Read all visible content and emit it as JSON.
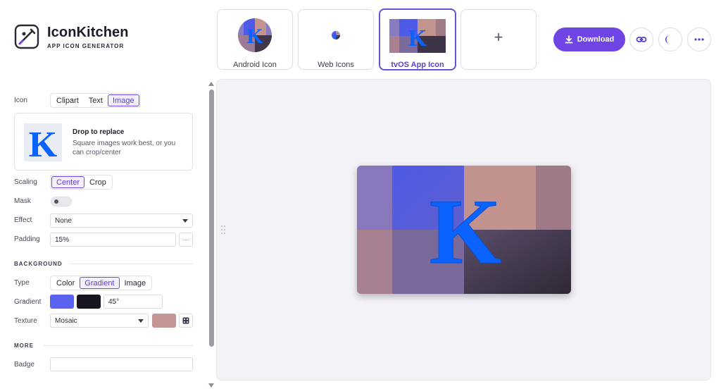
{
  "app": {
    "title": "IconKitchen",
    "subtitle": "APP ICON GENERATOR"
  },
  "targets": [
    {
      "label": "Android Icon",
      "selected": false
    },
    {
      "label": "Web Icons",
      "selected": false
    },
    {
      "label": "tvOS App Icon",
      "selected": true
    },
    {
      "label": "+",
      "selected": false
    }
  ],
  "actions": {
    "download_label": "Download",
    "link_icon": "link-icon",
    "theme_icon": "moon-icon",
    "more_icon": "more-horizontal-icon"
  },
  "icon_section": {
    "label": "Icon",
    "options": [
      "Clipart",
      "Text",
      "Image"
    ],
    "selected": "Image",
    "image_card": {
      "title": "Drop to replace",
      "description": "Square images work best, or you can crop/center",
      "thumb_letter": "K"
    }
  },
  "scaling": {
    "label": "Scaling",
    "options": [
      "Center",
      "Crop"
    ],
    "selected": "Center"
  },
  "mask": {
    "label": "Mask",
    "enabled": false
  },
  "effect": {
    "label": "Effect",
    "value": "None"
  },
  "padding": {
    "label": "Padding",
    "value": "15%",
    "more_label": "···"
  },
  "background": {
    "heading": "BACKGROUND",
    "type": {
      "label": "Type",
      "options": [
        "Color",
        "Gradient",
        "Image"
      ],
      "selected": "Gradient"
    },
    "gradient": {
      "label": "Gradient",
      "color_start": "#5a63f0",
      "color_end": "#17141f",
      "angle": "45°"
    },
    "texture": {
      "label": "Texture",
      "value": "Mosaic",
      "color": "#c49592"
    }
  },
  "more": {
    "heading": "MORE",
    "badge": {
      "label": "Badge",
      "value": ""
    }
  },
  "preview": {
    "letter": "K",
    "letter_color": "#0a63ff"
  },
  "colors": {
    "accent": "#6f45e6",
    "accent_text": "#5b3ccf"
  }
}
